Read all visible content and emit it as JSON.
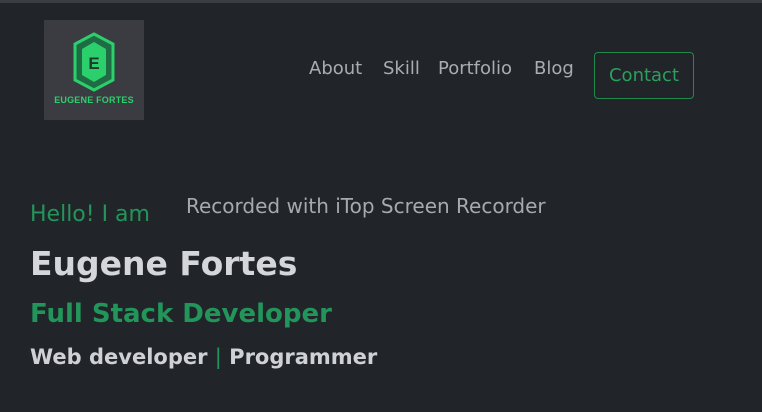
{
  "brand": {
    "logo_letter": "E",
    "logo_text": "EUGENE FORTES",
    "accent_color": "#22965a",
    "logo_color": "#2bd06c"
  },
  "nav": {
    "items": [
      {
        "label": "About"
      },
      {
        "label": "Skill"
      },
      {
        "label": "Portfolio"
      },
      {
        "label": "Blog"
      }
    ],
    "contact_label": "Contact"
  },
  "hero": {
    "greeting": "Hello! I am",
    "name": "Eugene Fortes",
    "role": "Full Stack Developer",
    "skills": [
      "Web developer",
      "Programmer"
    ],
    "separator": "|"
  },
  "overlay": {
    "watermark": "Recorded with iTop Screen Recorder"
  }
}
